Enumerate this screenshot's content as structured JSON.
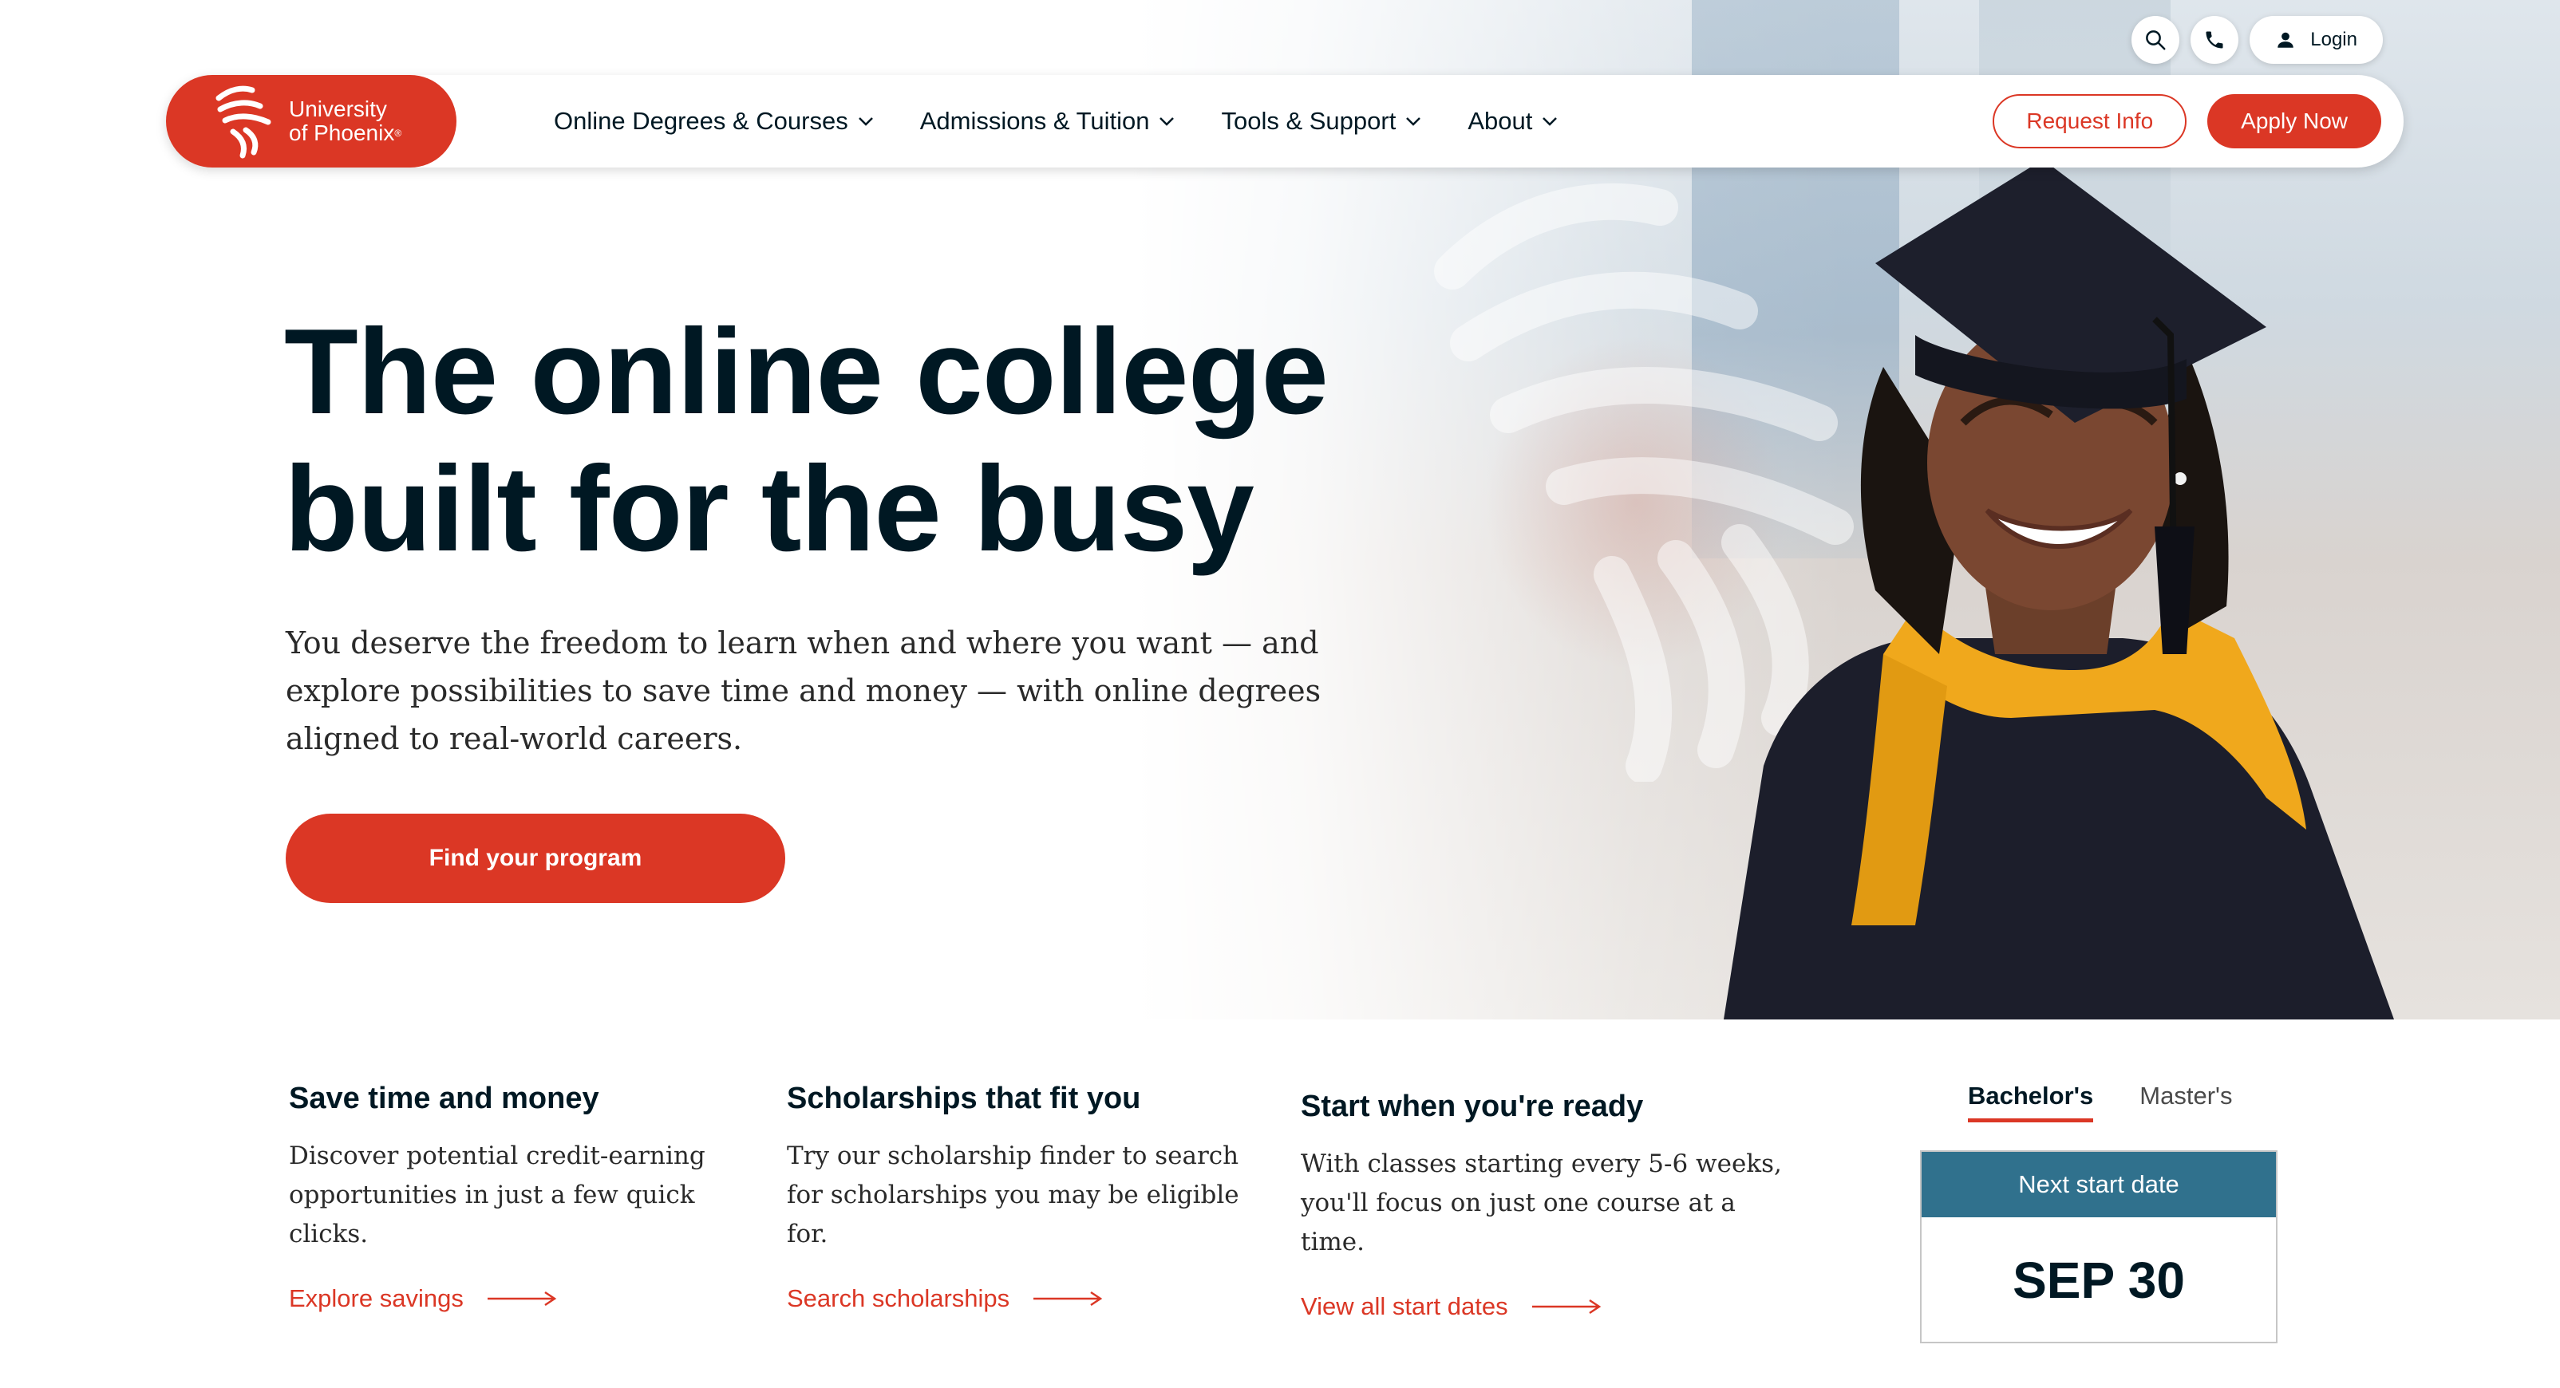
{
  "brand": {
    "name_line1": "University",
    "name_line2": "of Phoenix",
    "reg_mark": "®",
    "color": "#db3725"
  },
  "utility": {
    "search_icon": "search-icon",
    "phone_icon": "phone-icon",
    "login_label": "Login"
  },
  "nav": {
    "items": [
      {
        "label": "Online Degrees & Courses"
      },
      {
        "label": "Admissions & Tuition"
      },
      {
        "label": "Tools & Support"
      },
      {
        "label": "About"
      }
    ],
    "request_info": "Request Info",
    "apply_now": "Apply Now"
  },
  "hero": {
    "title_line1": "The online college",
    "title_line2": "built for the busy",
    "subtitle": "You deserve the freedom to learn when and where you want — and explore possibilities to save time and money — with online degrees aligned to real-world careers.",
    "cta": "Find your program"
  },
  "features": [
    {
      "title": "Save time and money",
      "text": "Discover potential credit-earning opportunities in just a few quick clicks.",
      "link": "Explore savings"
    },
    {
      "title": "Scholarships that fit you",
      "text": "Try our scholarship finder to search for scholarships you may be eligible for.",
      "link": "Search scholarships"
    },
    {
      "title": "Start when you're ready",
      "text": "With classes starting every 5-6 weeks, you'll focus on just one course at a time.",
      "link": "View all start dates"
    }
  ],
  "start_widget": {
    "tabs": [
      "Bachelor's",
      "Master's"
    ],
    "active_tab": "Bachelor's",
    "heading": "Next start date",
    "date": "SEP 30",
    "header_color": "#30718d"
  }
}
